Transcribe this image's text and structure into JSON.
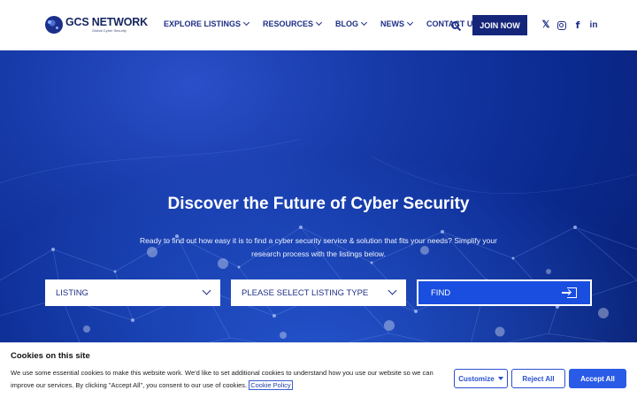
{
  "header": {
    "logo": {
      "name": "GCS NETWORK",
      "tagline": "Global Cyber Security"
    },
    "nav": [
      {
        "label": "EXPLORE LISTINGS",
        "has_dropdown": true
      },
      {
        "label": "RESOURCES",
        "has_dropdown": true
      },
      {
        "label": "BLOG",
        "has_dropdown": true
      },
      {
        "label": "NEWS",
        "has_dropdown": true
      },
      {
        "label": "CONTACT US",
        "has_dropdown": false
      }
    ],
    "search_icon": "search-icon",
    "join_label": "JOIN NOW",
    "socials": [
      {
        "name": "x-icon",
        "glyph": "𝕏"
      },
      {
        "name": "instagram-icon",
        "glyph": ""
      },
      {
        "name": "facebook-icon",
        "glyph": "f"
      },
      {
        "name": "linkedin-icon",
        "glyph": "in"
      }
    ]
  },
  "hero": {
    "title": "Discover the Future of Cyber Security",
    "subtitle": "Ready to find out how easy it is to find a cyber security service & solution that fits your needs? Simplify your research process with the listings below.",
    "listing_select": "LISTING",
    "type_select": "PLEASE SELECT LISTING TYPE",
    "find_label": "FIND"
  },
  "cookie": {
    "title": "Cookies on this site",
    "text": "We use some essential cookies to make this website work. We'd like to set additional cookies to understand how you use our website so we can improve our services. By clicking \"Accept All\", you consent to our use of cookies.",
    "policy_link": "Cookie Policy",
    "customize_label": "Customize",
    "reject_label": "Reject All",
    "accept_label": "Accept All"
  },
  "colors": {
    "brand_navy": "#15267a",
    "hero_blue": "#0b2a90",
    "accent_blue": "#2a5be6"
  }
}
